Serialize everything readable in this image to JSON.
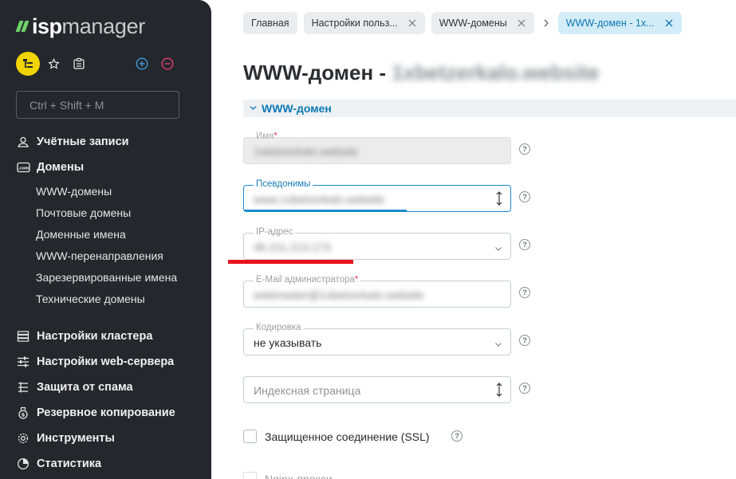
{
  "brand": {
    "logo_isp": "isp",
    "logo_manager": "manager"
  },
  "search": {
    "placeholder": "Ctrl + Shift + M"
  },
  "nav": {
    "accounts": "Учётные записи",
    "domains": "Домены",
    "domain_items": [
      "WWW-домены",
      "Почтовые домены",
      "Доменные имена",
      "WWW-перенаправления",
      "Зарезервированные имена",
      "Технические домены"
    ],
    "cluster": "Настройки кластера",
    "webserver": "Настройки web-сервера",
    "spam": "Защита от спама",
    "backup": "Резервное копирование",
    "tools": "Инструменты",
    "stats": "Статистика"
  },
  "tabs": [
    {
      "label": "Главная"
    },
    {
      "label": "Настройки польз..."
    },
    {
      "label": "WWW-домены"
    },
    {
      "label": "WWW-домен - 1x..."
    }
  ],
  "page": {
    "title": "WWW-домен - ",
    "title_blurred": "1xbetzerkalo.website",
    "section": "WWW-домен"
  },
  "form": {
    "name": {
      "label": "Имя",
      "value": "1xbetzerkalo.website"
    },
    "aliases": {
      "label": "Псевдонимы",
      "value": "www.1xbetzerkalo.website"
    },
    "ip": {
      "label": "IP-адрес",
      "value": "46.211.213.173"
    },
    "email": {
      "label": "E-Mail администратора",
      "value": "webmaster@1xbetzerkalo.website"
    },
    "encoding": {
      "label": "Кодировка",
      "value": "не указывать"
    },
    "index": {
      "placeholder": "Индексная страница"
    },
    "ssl": {
      "label": "Защищенное соединение (SSL)"
    },
    "nginx": {
      "label": "Nginx-прокси"
    }
  },
  "colors": {
    "accent": "#0d79b4",
    "sidebar_bg": "#24272b",
    "logo_green": "#6fd36b",
    "avatar": "#f2d400",
    "marker": "#e8131b"
  }
}
